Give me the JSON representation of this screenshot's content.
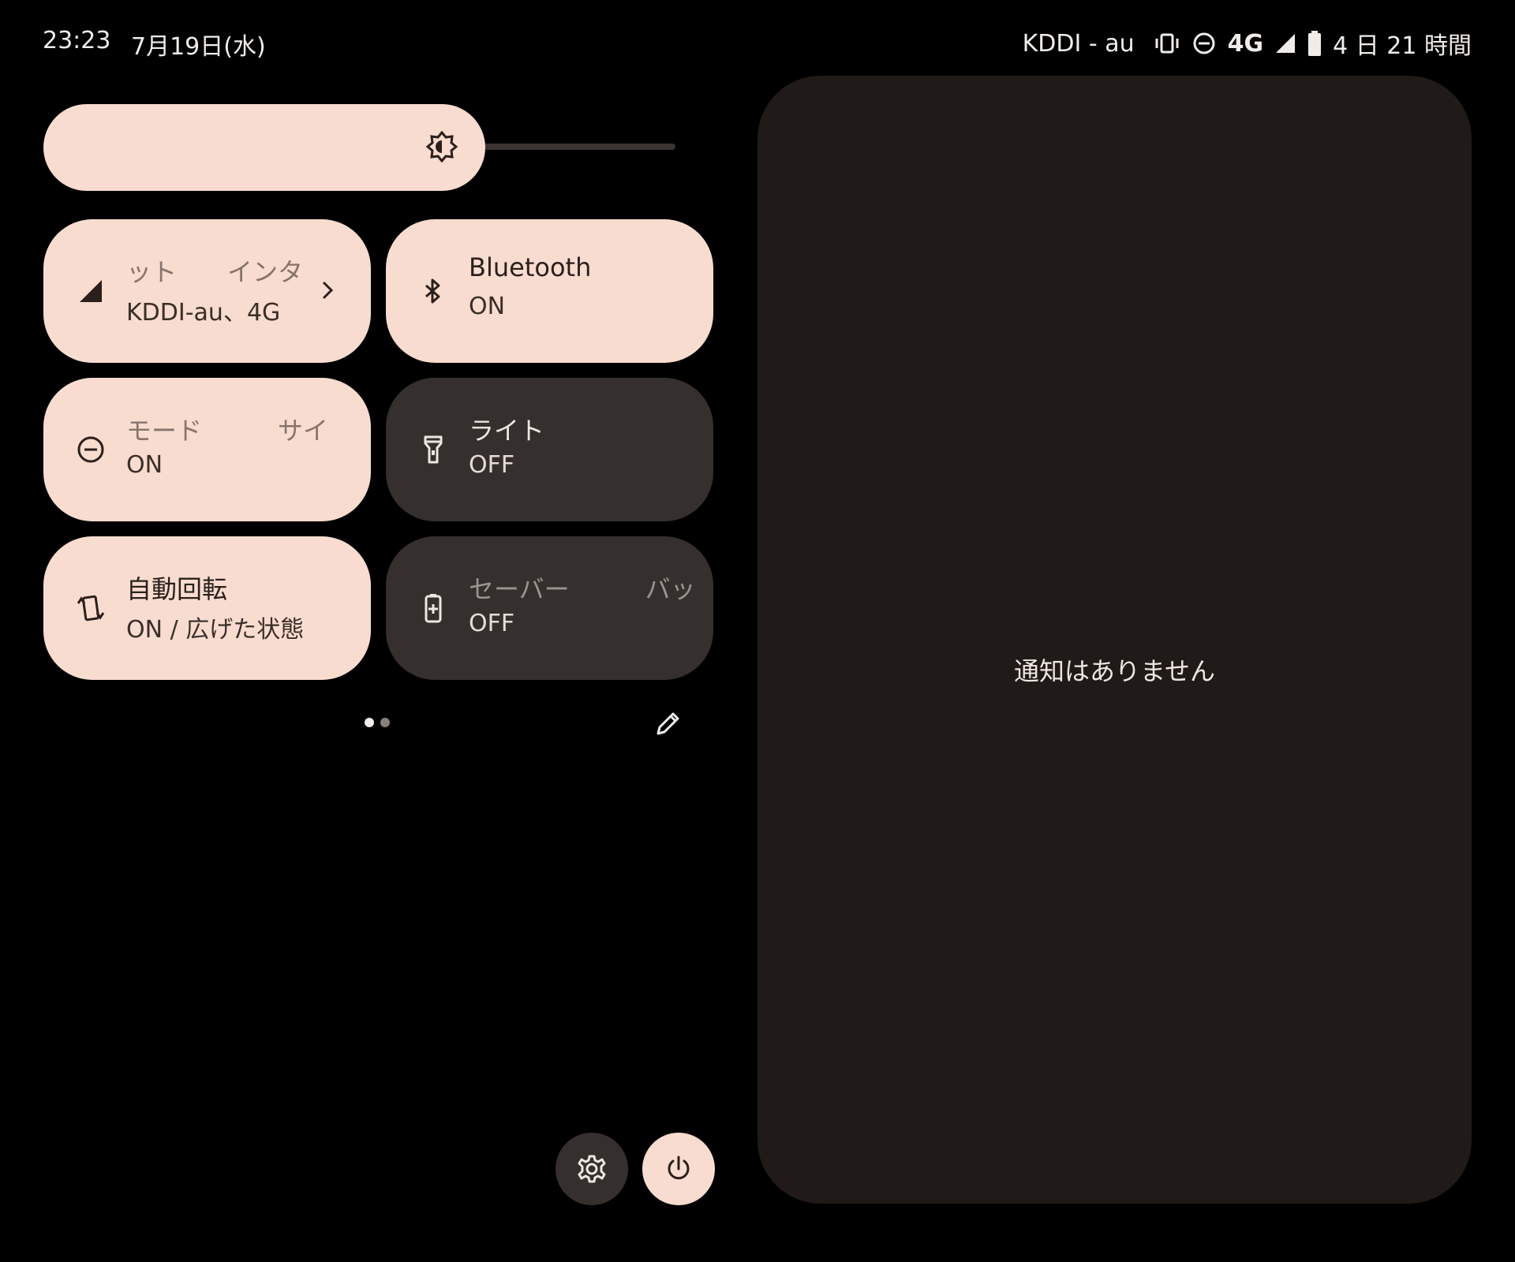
{
  "status_bar": {
    "time": "23:23",
    "date": "7月19日(水)",
    "carrier": "KDDI - au",
    "network_type": "4G",
    "battery_text": "4 日 21 時間",
    "icons": [
      "vibrate-icon",
      "dnd-icon",
      "signal-icon",
      "battery-icon"
    ]
  },
  "brightness": {
    "level": 0.7,
    "icon": "brightness-auto-icon"
  },
  "tiles": [
    {
      "icon": "signal-icon",
      "label": "ット　　インタ",
      "sub": "KDDI-au、4G",
      "state": "on",
      "has_chevron": true
    },
    {
      "icon": "bluetooth-icon",
      "label": "Bluetooth",
      "sub": "ON",
      "state": "on"
    },
    {
      "icon": "dnd-icon",
      "label": "モード　　　サイ",
      "sub": "ON",
      "state": "on"
    },
    {
      "icon": "flashlight-icon",
      "label": "ライト",
      "sub": "OFF",
      "state": "off"
    },
    {
      "icon": "rotate-icon",
      "label": "自動回転",
      "sub": "ON / 広げた状態",
      "state": "on"
    },
    {
      "icon": "battery-saver-icon",
      "label": "セーバー　　　バッ",
      "sub": "OFF",
      "state": "off"
    }
  ],
  "pager": {
    "pages": 2,
    "current": 1
  },
  "notifications": {
    "empty_text": "通知はありません"
  },
  "colors": {
    "tile_on": "#f8dccf",
    "tile_off": "#35302d",
    "panel": "#201b18",
    "background": "#000000"
  }
}
